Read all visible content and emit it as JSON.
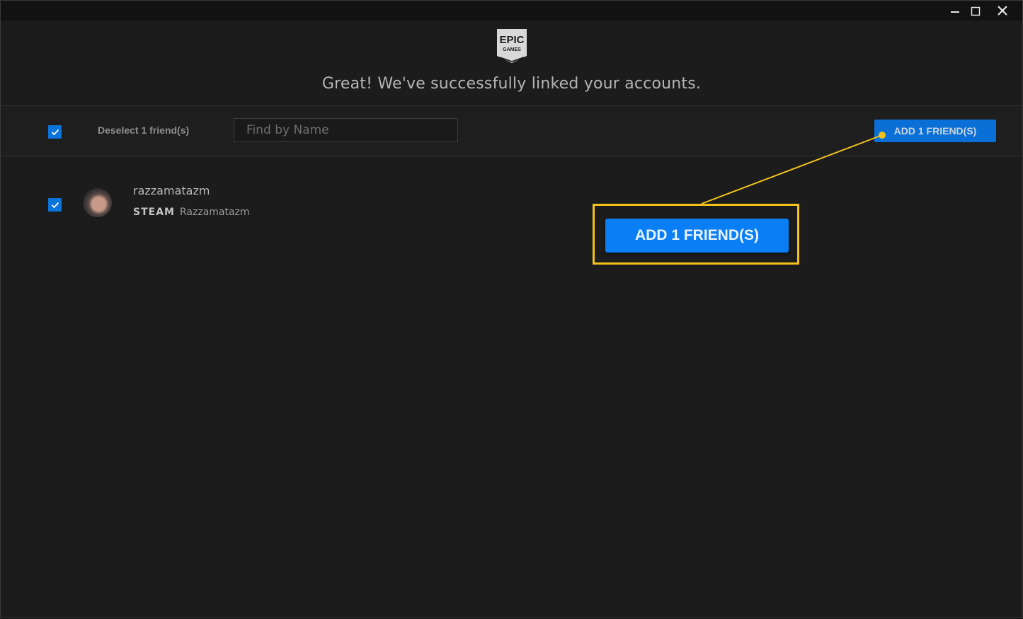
{
  "window": {
    "controls": [
      "minimize-icon",
      "maximize-icon",
      "close-icon"
    ]
  },
  "header": {
    "logo_top": "EPIC",
    "logo_bottom": "GAMES",
    "headline": "Great! We've successfully linked your accounts."
  },
  "toolbar": {
    "select_all_checked": true,
    "deselect_label": "Deselect 1 friend(s)",
    "search_placeholder": "Find by Name",
    "add_button_label": "ADD 1 FRIEND(S)"
  },
  "friends": [
    {
      "checked": true,
      "name": "razzamatazm",
      "platform": "STEAM",
      "platform_username": "Razzamatazm"
    }
  ],
  "callout": {
    "button_label": "ADD 1 FRIEND(S)",
    "highlight_color": "#f2c21b"
  },
  "colors": {
    "accent": "#0a74da",
    "background": "#1c1c1c"
  }
}
